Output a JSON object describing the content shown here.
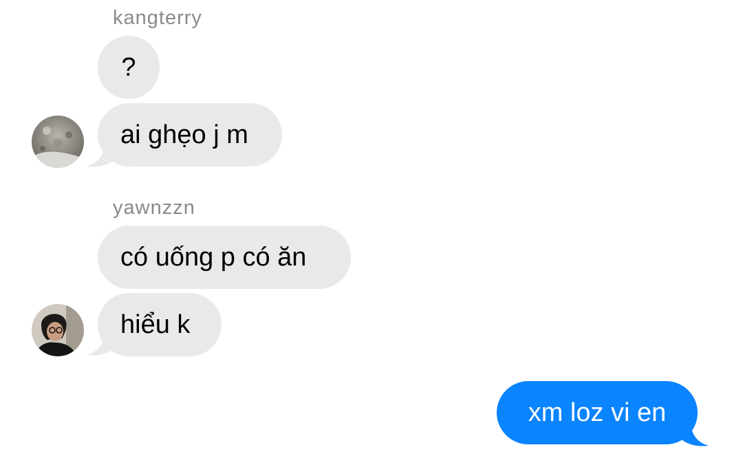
{
  "conversation": {
    "group1": {
      "sender": "kangterry",
      "avatar_icon": "person-avatar-icon",
      "messages": [
        "?",
        "ai ghẹo j m"
      ]
    },
    "group2": {
      "sender": "yawnzzn",
      "avatar_icon": "person-avatar-icon",
      "messages": [
        "có uống p có ăn",
        "hiểu k"
      ]
    },
    "outgoing": {
      "messages": [
        "xm loz vi en"
      ]
    }
  },
  "colors": {
    "received_bubble": "#e9e9eb",
    "sent_bubble": "#0a84ff",
    "sender_name": "#8a8a8e"
  }
}
